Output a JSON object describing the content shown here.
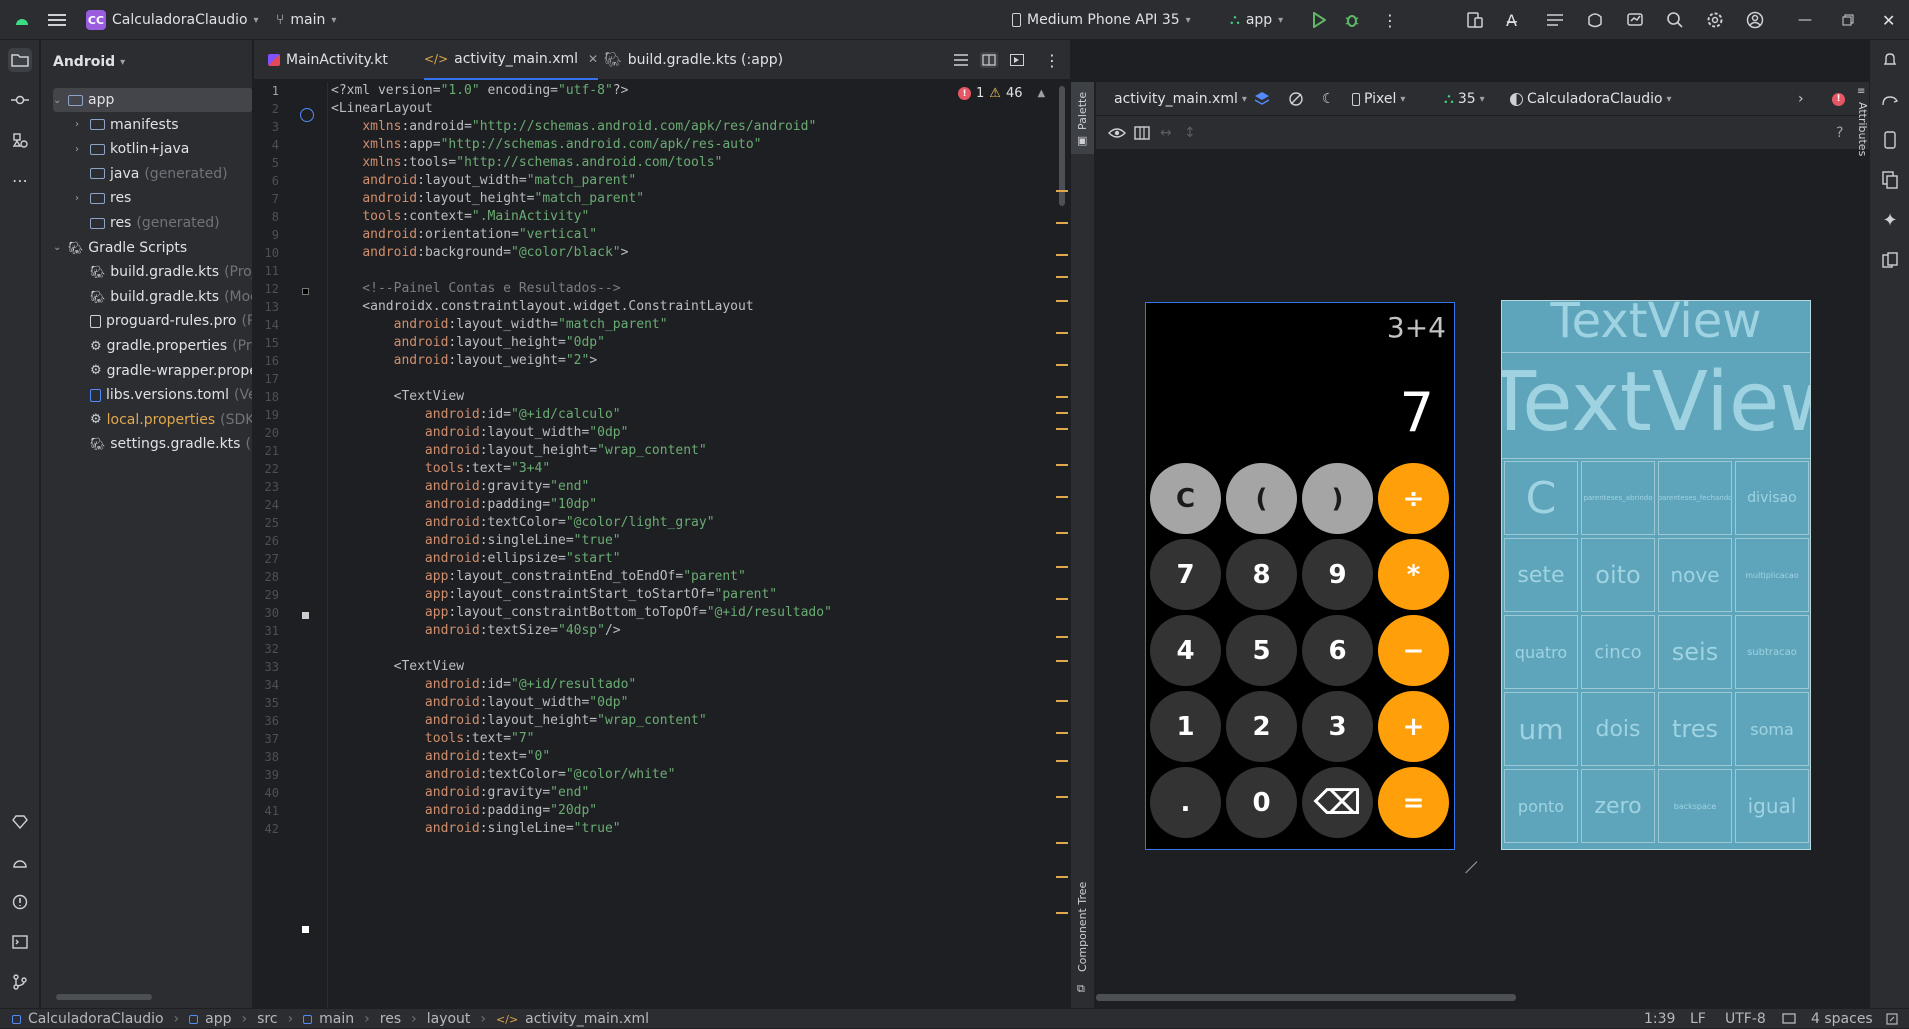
{
  "titlebar": {
    "project_badge": "CC",
    "project": "CalculadoraClaudio",
    "branch": "main",
    "device": "Medium Phone API 35",
    "run_config": "app"
  },
  "project_panel": {
    "view": "Android",
    "items": [
      {
        "label": "app",
        "extra": "",
        "orange": false
      },
      {
        "label": "manifests",
        "extra": "",
        "orange": false
      },
      {
        "label": "kotlin+java",
        "extra": "",
        "orange": false
      },
      {
        "label": "java",
        "extra": "(generated)",
        "orange": false
      },
      {
        "label": "res",
        "extra": "",
        "orange": false
      },
      {
        "label": "res",
        "extra": "(generated)",
        "orange": false
      },
      {
        "label": "Gradle Scripts",
        "extra": "",
        "orange": false
      },
      {
        "label": "build.gradle.kts",
        "extra": "(Proje",
        "orange": false
      },
      {
        "label": "build.gradle.kts",
        "extra": "(Mod",
        "orange": false
      },
      {
        "label": "proguard-rules.pro",
        "extra": "(P",
        "orange": false
      },
      {
        "label": "gradle.properties",
        "extra": "(Pro",
        "orange": false
      },
      {
        "label": "gradle-wrapper.prope",
        "extra": "",
        "orange": false
      },
      {
        "label": "libs.versions.toml",
        "extra": "(Ver",
        "orange": false
      },
      {
        "label": "local.properties",
        "extra": "(SDK",
        "orange": true
      },
      {
        "label": "settings.gradle.kts",
        "extra": "(P",
        "orange": false
      }
    ]
  },
  "tabs": [
    {
      "label": "MainActivity.kt"
    },
    {
      "label": "activity_main.xml"
    },
    {
      "label": "build.gradle.kts (:app)"
    }
  ],
  "inspections": {
    "errors": "1",
    "warnings": "46"
  },
  "code_lines": [
    "<?xml version=\"1.0\" encoding=\"utf-8\"?>",
    "<LinearLayout",
    "    xmlns:android=\"http://schemas.android.com/apk/res/android\"",
    "    xmlns:app=\"http://schemas.android.com/apk/res-auto\"",
    "    xmlns:tools=\"http://schemas.android.com/tools\"",
    "    android:layout_width=\"match_parent\"",
    "    android:layout_height=\"match_parent\"",
    "    tools:context=\".MainActivity\"",
    "    android:orientation=\"vertical\"",
    "    android:background=\"@color/black\">",
    "",
    "    <!--Painel Contas e Resultados-->",
    "    <androidx.constraintlayout.widget.ConstraintLayout",
    "        android:layout_width=\"match_parent\"",
    "        android:layout_height=\"0dp\"",
    "        android:layout_weight=\"2\">",
    "",
    "        <TextView",
    "            android:id=\"@+id/calculo\"",
    "            android:layout_width=\"0dp\"",
    "            android:layout_height=\"wrap_content\"",
    "            tools:text=\"3+4\"",
    "            android:gravity=\"end\"",
    "            android:padding=\"10dp\"",
    "            android:textColor=\"@color/light_gray\"",
    "            android:singleLine=\"true\"",
    "            android:ellipsize=\"start\"",
    "            app:layout_constraintEnd_toEndOf=\"parent\"",
    "            app:layout_constraintStart_toStartOf=\"parent\"",
    "            app:layout_constraintBottom_toTopOf=\"@+id/resultado\"",
    "            android:textSize=\"40sp\"/>",
    "",
    "        <TextView",
    "            android:id=\"@+id/resultado\"",
    "            android:layout_width=\"0dp\"",
    "            android:layout_height=\"wrap_content\"",
    "            tools:text=\"7\"",
    "            android:text=\"0\"",
    "            android:textColor=\"@color/white\"",
    "            android:gravity=\"end\"",
    "            android:padding=\"20dp\"",
    "            android:singleLine=\"true\""
  ],
  "design": {
    "file": "activity_main.xml",
    "device": "Pixel",
    "api": "35",
    "theme": "CalculadoraClaudio"
  },
  "preview": {
    "calc_text": "3+4",
    "result_text": "7",
    "buttons": [
      {
        "label": "C",
        "kind": "gray"
      },
      {
        "label": "(",
        "kind": "gray"
      },
      {
        "label": ")",
        "kind": "gray"
      },
      {
        "label": "÷",
        "kind": "orange"
      },
      {
        "label": "7",
        "kind": "dark"
      },
      {
        "label": "8",
        "kind": "dark"
      },
      {
        "label": "9",
        "kind": "dark"
      },
      {
        "label": "*",
        "kind": "orange"
      },
      {
        "label": "4",
        "kind": "dark"
      },
      {
        "label": "5",
        "kind": "dark"
      },
      {
        "label": "6",
        "kind": "dark"
      },
      {
        "label": "−",
        "kind": "orange"
      },
      {
        "label": "1",
        "kind": "dark"
      },
      {
        "label": "2",
        "kind": "dark"
      },
      {
        "label": "3",
        "kind": "dark"
      },
      {
        "label": "+",
        "kind": "orange"
      },
      {
        "label": ".",
        "kind": "dark"
      },
      {
        "label": "0",
        "kind": "dark"
      },
      {
        "label": "⌫",
        "kind": "dark"
      },
      {
        "label": "=",
        "kind": "orange"
      }
    ]
  },
  "blueprint": {
    "top_text": "TextView",
    "big_text": "TextView",
    "cells": [
      "C",
      "parenteses_abrindo",
      "parenteses_fechando",
      "divisao",
      "sete",
      "oito",
      "nove",
      "multiplicacao",
      "quatro",
      "cinco",
      "seis",
      "subtracao",
      "um",
      "dois",
      "tres",
      "soma",
      "ponto",
      "zero",
      "backspace",
      "igual"
    ]
  },
  "side_labels": {
    "palette": "Palette",
    "component_tree": "Component Tree",
    "attributes": "Attributes"
  },
  "breadcrumb": [
    "CalculadoraClaudio",
    "app",
    "src",
    "main",
    "res",
    "layout",
    "activity_main.xml"
  ],
  "statusbar": {
    "position": "1:39",
    "line_sep": "LF",
    "encoding": "UTF-8",
    "indent": "4 spaces"
  },
  "colors": {
    "orange": "#FF9F0A",
    "gray": "#A5A5A5",
    "dark": "#333333",
    "blueprint": "#5ea5bb",
    "accent": "#3574f0"
  }
}
